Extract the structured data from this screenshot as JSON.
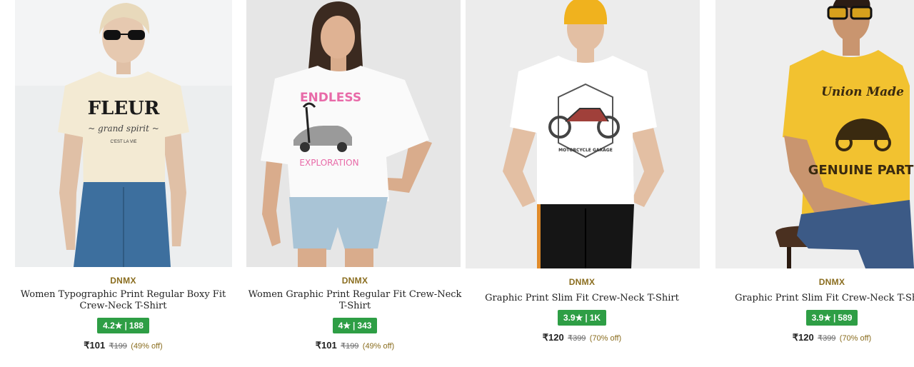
{
  "currency": "₹",
  "products": [
    {
      "brand": "DNMX",
      "title": "Women Typographic Print Regular Boxy Fit Crew-Neck T-Shirt",
      "rating": "4.2",
      "star": "★",
      "reviews": "188",
      "price": "₹101",
      "mrp": "₹199",
      "discount": "(49% off)",
      "print_text": "FLEUR",
      "print_sub": "C'EST LA VIE",
      "tee_color": "#f3ead3",
      "bottom_color": "#3d6f9e"
    },
    {
      "brand": "DNMX",
      "title": "Women Graphic Print Regular Fit Crew-Neck T-Shirt",
      "rating": "4",
      "star": "★",
      "reviews": "343",
      "price": "₹101",
      "mrp": "₹199",
      "discount": "(49% off)",
      "print_text": "ENDLESS",
      "print_sub": "EXPLORATION",
      "tee_color": "#fafafa",
      "bottom_color": "#a9c4d6"
    },
    {
      "brand": "DNMX",
      "title": "Graphic Print Slim Fit Crew-Neck T-Shirt",
      "rating": "3.9",
      "star": "★",
      "reviews": "1K",
      "price": "₹120",
      "mrp": "₹399",
      "discount": "(70% off)",
      "print_text": "MOTORCYCLE GARAGE",
      "print_sub": "",
      "tee_color": "#ffffff",
      "bottom_color": "#151515"
    },
    {
      "brand": "DNMX",
      "title": "Graphic Print Slim Fit Crew-Neck T-Shirt",
      "rating": "3.9",
      "star": "★",
      "reviews": "589",
      "price": "₹120",
      "mrp": "₹399",
      "discount": "(70% off)",
      "print_text": "Union Made",
      "print_sub": "GENUINE PARTS",
      "tee_color": "#f2c230",
      "bottom_color": "#3c5a86"
    }
  ],
  "colors": {
    "rating_bg": "#2e9e45",
    "brand": "#8a6d1f",
    "discount": "#8a6d1f"
  }
}
